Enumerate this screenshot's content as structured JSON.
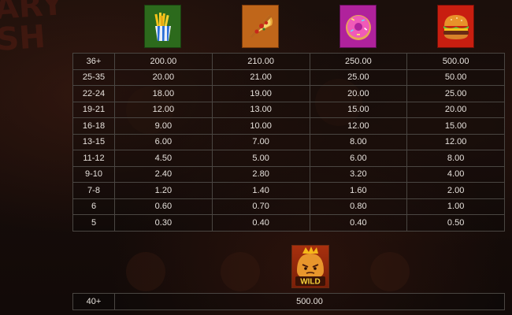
{
  "background": {
    "logo_text": "ARY\nSH"
  },
  "symbols": [
    {
      "name": "fries-icon",
      "bg": "#2c6a1c"
    },
    {
      "name": "pizza-icon",
      "bg": "#c0661a"
    },
    {
      "name": "donut-icon",
      "bg": "#b0229c"
    },
    {
      "name": "burger-icon",
      "bg": "#c81e10"
    }
  ],
  "paytable": {
    "rows": [
      {
        "count": "36+",
        "values": [
          "200.00",
          "210.00",
          "250.00",
          "500.00"
        ]
      },
      {
        "count": "25-35",
        "values": [
          "20.00",
          "21.00",
          "25.00",
          "50.00"
        ]
      },
      {
        "count": "22-24",
        "values": [
          "18.00",
          "19.00",
          "20.00",
          "25.00"
        ]
      },
      {
        "count": "19-21",
        "values": [
          "12.00",
          "13.00",
          "15.00",
          "20.00"
        ]
      },
      {
        "count": "16-18",
        "values": [
          "9.00",
          "10.00",
          "12.00",
          "15.00"
        ]
      },
      {
        "count": "13-15",
        "values": [
          "6.00",
          "7.00",
          "8.00",
          "12.00"
        ]
      },
      {
        "count": "11-12",
        "values": [
          "4.50",
          "5.00",
          "6.00",
          "8.00"
        ]
      },
      {
        "count": "9-10",
        "values": [
          "2.40",
          "2.80",
          "3.20",
          "4.00"
        ]
      },
      {
        "count": "7-8",
        "values": [
          "1.20",
          "1.40",
          "1.60",
          "2.00"
        ]
      },
      {
        "count": "6",
        "values": [
          "0.60",
          "0.70",
          "0.80",
          "1.00"
        ]
      },
      {
        "count": "5",
        "values": [
          "0.30",
          "0.40",
          "0.40",
          "0.50"
        ]
      }
    ]
  },
  "wild": {
    "label": "WILD",
    "count": "40+",
    "value": "500.00"
  }
}
